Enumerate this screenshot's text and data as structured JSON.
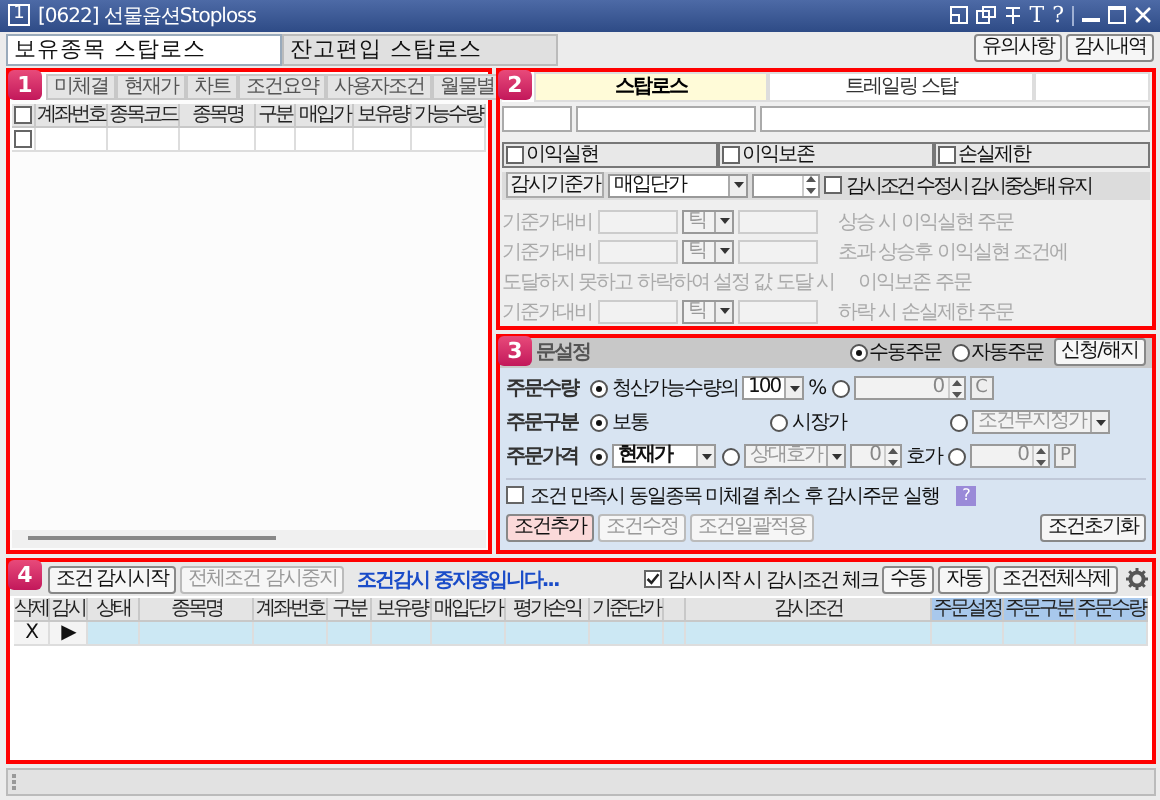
{
  "window": {
    "app_number": "1",
    "title": "[0622] 선물옵션Stoploss",
    "tool_labels": [
      "T",
      "?"
    ]
  },
  "top_tabs": [
    {
      "label": "보유종목 스탑로스",
      "selected": true
    },
    {
      "label": "잔고편입 스탑로스",
      "selected": false
    }
  ],
  "top_buttons": [
    "유의사항",
    "감시내역"
  ],
  "holdings": {
    "badge": "1",
    "tabs": [
      {
        "label": "미체결",
        "selected": false
      },
      {
        "label": "현재가",
        "selected": false
      },
      {
        "label": "차트",
        "selected": false
      },
      {
        "label": "조건요약",
        "selected": false
      },
      {
        "label": "사용자조건",
        "selected": false
      },
      {
        "label": "월물별",
        "selected": false
      }
    ],
    "header_checked": false,
    "columns": [
      "계좌번호",
      "종목코드",
      "종목명",
      "구분",
      "매입가",
      "보유량",
      "가능수량"
    ],
    "rows": [
      {
        "checked": false
      }
    ]
  },
  "stoploss": {
    "badge": "2",
    "tabs": [
      {
        "label": "스탑로스",
        "selected": true
      },
      {
        "label": "트레일링 스탑",
        "selected": false
      }
    ],
    "options": [
      {
        "label": "이익실현",
        "checked": false
      },
      {
        "label": "이익보존",
        "checked": false
      },
      {
        "label": "손실제한",
        "checked": false
      }
    ],
    "base_price": {
      "label": "감시기준가",
      "value": "매입단가"
    },
    "keep_option": {
      "label": "감시조건 수정시 감시중상태 유지",
      "checked": false
    },
    "rules": [
      {
        "kind": "price",
        "label": "기준가대비",
        "unit": "틱",
        "text": "상승 시 이익실현 주문",
        "disabled": true
      },
      {
        "kind": "price",
        "label": "기준가대비",
        "unit": "틱",
        "text": "초과 상승후 이익실현 조건에",
        "disabled": true
      },
      {
        "kind": "note",
        "text": "도달하지 못하고 하락하여 설정 값 도달 시",
        "tail": "이익보존 주문",
        "disabled": true
      },
      {
        "kind": "price",
        "label": "기준가대비",
        "unit": "틱",
        "text": "하락 시 손실제한 주문",
        "disabled": true
      }
    ]
  },
  "order": {
    "badge": "3",
    "title": "문설정",
    "modes": [
      {
        "label": "수동주문",
        "selected": true
      },
      {
        "label": "자동주문",
        "selected": false
      }
    ],
    "apply_button": "신청/해지",
    "rows": [
      {
        "label": "주문수량",
        "options": [
          {
            "kind": "ratio",
            "label": "청산가능수량의",
            "value": "100",
            "unit": "%",
            "selected": true
          },
          {
            "kind": "spin",
            "value": "0",
            "button": "C",
            "selected": false
          }
        ]
      },
      {
        "label": "주문구분",
        "options": [
          {
            "kind": "plain",
            "label": "보통",
            "selected": true
          },
          {
            "kind": "plain",
            "label": "시장가",
            "selected": false
          },
          {
            "kind": "combo",
            "value": "조건부지정가",
            "selected": false
          }
        ]
      },
      {
        "label": "주문가격",
        "options": [
          {
            "kind": "combo",
            "value": "현재가",
            "selected": true
          },
          {
            "kind": "combo_spin",
            "value": "상대호가",
            "count": "0",
            "unit": "호가",
            "selected": false
          },
          {
            "kind": "spin",
            "value": "0",
            "button": "P",
            "selected": false
          }
        ]
      }
    ],
    "cancel_option": {
      "label": "조건 만족시 동일종목 미체결 취소 후 감시주문 실행",
      "checked": false,
      "help": "?"
    },
    "buttons": [
      {
        "label": "조건추가",
        "highlighted": true,
        "disabled": false
      },
      {
        "label": "조건수정",
        "highlighted": false,
        "disabled": true
      },
      {
        "label": "조건일괄적용",
        "highlighted": false,
        "disabled": true
      }
    ],
    "reset_button": "조건초기화"
  },
  "monitor": {
    "badge": "4",
    "start_button": {
      "label": "조건 감시시작",
      "disabled": false
    },
    "stop_button": {
      "label": "전체조건 감시중지",
      "disabled": true
    },
    "status": "조건감시 중지중입니다...",
    "check_option": {
      "label": "감시시작 시 감시조건 체크",
      "checked": true
    },
    "buttons": [
      "수동",
      "자동",
      "조건전체삭제"
    ],
    "columns": [
      {
        "label": "삭제",
        "highlighted": false
      },
      {
        "label": "감시",
        "highlighted": false
      },
      {
        "label": "상태",
        "highlighted": false
      },
      {
        "label": "종목명",
        "highlighted": false
      },
      {
        "label": "계좌번호",
        "highlighted": false
      },
      {
        "label": "구분",
        "highlighted": false
      },
      {
        "label": "보유량",
        "highlighted": false
      },
      {
        "label": "매입단가",
        "highlighted": false
      },
      {
        "label": "평가손익",
        "highlighted": false
      },
      {
        "label": "기준단가",
        "highlighted": false
      },
      {
        "highlighted": false
      },
      {
        "label": "감시조건",
        "highlighted": false
      },
      {
        "label": "주문설정",
        "highlighted": true
      },
      {
        "label": "주문구분",
        "highlighted": true
      },
      {
        "label": "주문수량",
        "highlighted": true
      }
    ],
    "rows": [
      {
        "cells": [
          "X",
          "▶"
        ]
      }
    ]
  }
}
